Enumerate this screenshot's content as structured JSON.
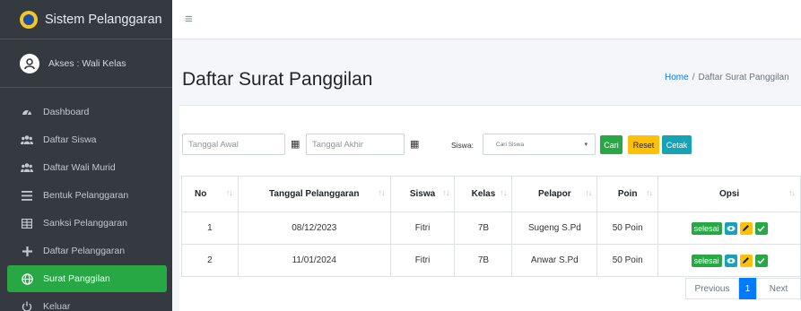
{
  "brand": {
    "title": "Sistem Pelanggaran",
    "logo_icon": "school-logo-icon"
  },
  "user": {
    "label": "Akses : Wali Kelas"
  },
  "sidebar": {
    "items": [
      {
        "label": "Dashboard",
        "icon": "tachometer-icon"
      },
      {
        "label": "Daftar Siswa",
        "icon": "users-icon"
      },
      {
        "label": "Daftar Wali Murid",
        "icon": "users-icon"
      },
      {
        "label": "Bentuk Pelanggaran",
        "icon": "list-icon"
      },
      {
        "label": "Sanksi Pelanggaran",
        "icon": "table-icon"
      },
      {
        "label": "Daftar Pelanggaran",
        "icon": "plus-icon"
      },
      {
        "label": "Surat Panggilan",
        "icon": "globe-icon",
        "active": true
      },
      {
        "label": "Keluar",
        "icon": "power-icon"
      }
    ]
  },
  "page": {
    "title": "Daftar Surat Panggilan"
  },
  "breadcrumb": {
    "home": "Home",
    "separator": "/",
    "current": "Daftar Surat Panggilan"
  },
  "filters": {
    "start_date_placeholder": "Tanggal Awal",
    "end_date_placeholder": "Tanggal Akhir",
    "siswa_label": "Siswa:",
    "siswa_selected": "Cari Siswa",
    "buttons": {
      "search": "Cari",
      "reset": "Reset",
      "print": "Cetak"
    }
  },
  "table": {
    "headers": [
      "No",
      "Tanggal Pelanggaran",
      "Siswa",
      "Kelas",
      "Pelapor",
      "Poin",
      "Opsi"
    ],
    "rows": [
      {
        "no": "1",
        "tanggal": "08/12/2023",
        "siswa": "Fitri",
        "kelas": "7B",
        "pelapor": "Sugeng S.Pd",
        "poin": "50 Poin",
        "status": "selesai"
      },
      {
        "no": "2",
        "tanggal": "11/01/2024",
        "siswa": "Fitri",
        "kelas": "7B",
        "pelapor": "Anwar S.Pd",
        "poin": "50 Poin",
        "status": "selesai"
      }
    ]
  },
  "pagination": {
    "previous": "Previous",
    "current": "1",
    "next": "Next"
  },
  "colors": {
    "sidebar": "#343a40",
    "active": "#28a745",
    "primary": "#007bff",
    "warning": "#ffc107",
    "info": "#17a2b8"
  }
}
